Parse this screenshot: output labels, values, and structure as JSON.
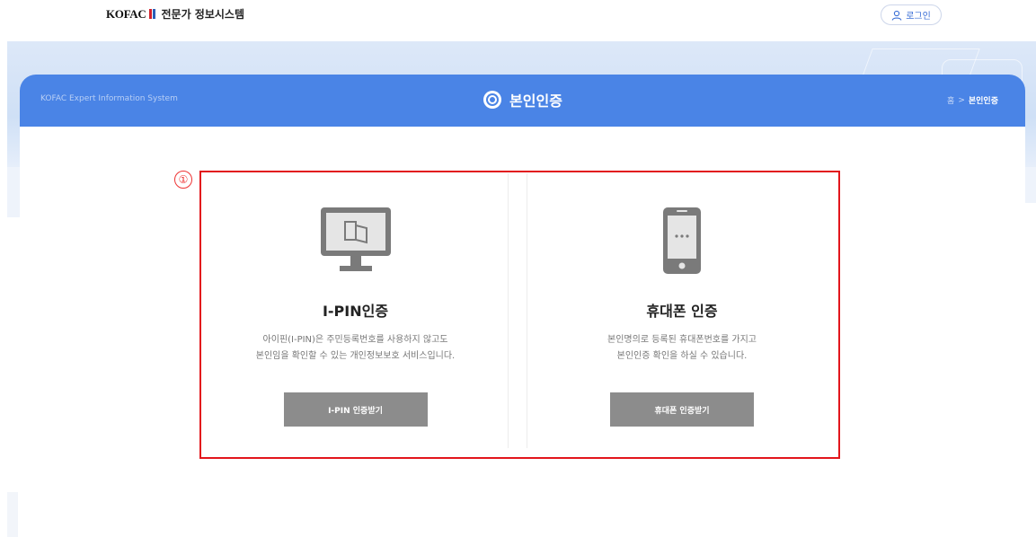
{
  "header": {
    "logo_word": "KOFAC",
    "logo_sub": "전문가 정보시스템",
    "login_label": "로그인"
  },
  "titlebar": {
    "system_name": "KOFAC Expert Information System",
    "title": "본인인증",
    "breadcrumb": {
      "home": "홈",
      "separator": ">",
      "current": "본인인증"
    }
  },
  "annotation": {
    "number": "①"
  },
  "ipin": {
    "title": "I-PIN인증",
    "desc_line1": "아이핀(I-PIN)은 주민등록번호를 사용하지 않고도",
    "desc_line2": "본인임을 확인할 수 있는 개인정보보호 서비스입니다.",
    "button": "I-PIN 인증받기",
    "icon": "monitor-icon"
  },
  "phone": {
    "title": "휴대폰 인증",
    "desc_line1": "본인명의로 등록된 휴대폰번호를 가지고",
    "desc_line2": "본인인증 확인을 하실 수 있습니다.",
    "button": "휴대폰 인증받기",
    "icon": "mobile-phone-icon"
  },
  "colors": {
    "accent": "#4a84e6",
    "button_gray": "#8c8c8c",
    "annotation_red": "#e2161c"
  }
}
